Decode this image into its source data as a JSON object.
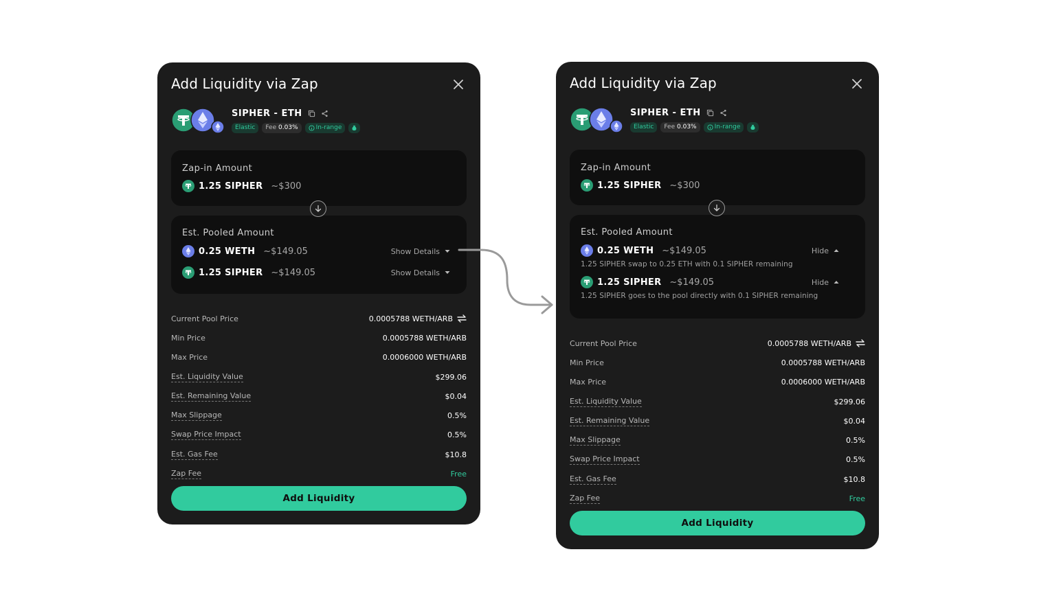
{
  "modal_title": "Add Liquidity via Zap",
  "pair": {
    "name": "SIPHER - ETH",
    "badges": {
      "elastic": "Elastic",
      "fee_label": "Fee",
      "fee_value": "0.03%",
      "range": "In-range"
    }
  },
  "zap_in": {
    "label": "Zap-in Amount",
    "amount": "1.25 SIPHER",
    "usd": "~$300"
  },
  "pooled": {
    "label": "Est. Pooled Amount",
    "items": [
      {
        "amount": "0.25 WETH",
        "usd": "~$149.05",
        "icon": "eth-icon",
        "detail": "1.25 SIPHER swap to 0.25 ETH  with 0.1 SIPHER remaining"
      },
      {
        "amount": "1.25 SIPHER",
        "usd": "~$149.05",
        "icon": "sipher-icon",
        "detail": "1.25 SIPHER goes to the pool directly with 0.1 SIPHER remaining"
      }
    ],
    "show_label": "Show Details",
    "hide_label": "Hide"
  },
  "info_rows": [
    {
      "label": "Current Pool Price",
      "value": "0.0005788 WETH/ARB",
      "dotted": false
    },
    {
      "label": "Min Price",
      "value": "0.0005788 WETH/ARB",
      "dotted": false
    },
    {
      "label": "Max Price",
      "value": "0.0006000 WETH/ARB",
      "dotted": false
    },
    {
      "label": "Est. Liquidity Value",
      "value": "$299.06",
      "dotted": true
    },
    {
      "label": "Est. Remaining Value",
      "value": "$0.04",
      "dotted": true
    },
    {
      "label": "Max Slippage",
      "value": "0.5%",
      "dotted": true
    },
    {
      "label": "Swap Price Impact",
      "value": "0.5%",
      "dotted": true
    },
    {
      "label": "Est. Gas Fee",
      "value": "$10.8",
      "dotted": true
    },
    {
      "label": "Zap Fee",
      "value": "Free",
      "dotted": true
    }
  ],
  "add_button_label": "Add Liquidity",
  "colors": {
    "accent": "#31cb9e",
    "modal_bg": "#1c1c1c",
    "card_bg": "#0f0f0f",
    "sipher_token": "#2a9d74",
    "eth_token": "#6b7ee8"
  }
}
